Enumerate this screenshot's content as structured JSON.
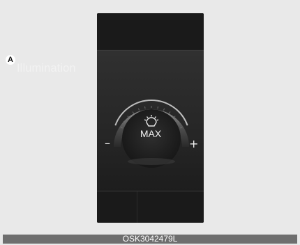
{
  "screen": {
    "marker_label": "A",
    "title": "Illumination",
    "gauge": {
      "value_label": "MAX",
      "decrease_label": "–",
      "increase_label": "+",
      "icon": "dashboard-light-icon",
      "level_fraction": 1.0
    }
  },
  "figure_code": "OSK3042479L",
  "colors": {
    "background": "#e9e9e9",
    "display": "#1e1e1e",
    "text": "#f0f0f0",
    "code_bar": "#6e6e6e"
  }
}
